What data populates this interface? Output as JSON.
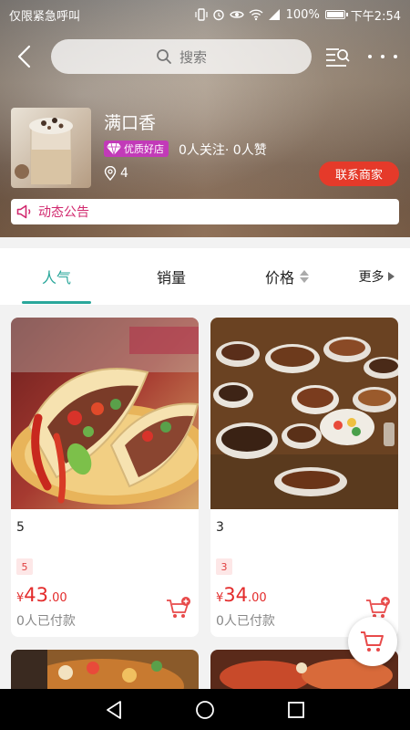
{
  "status_bar": {
    "carrier": "仅限紧急呼叫",
    "battery": "100%",
    "time": "下午2:54"
  },
  "nav": {
    "search_placeholder": "搜索"
  },
  "store": {
    "name": "满口香",
    "badge": "优质好店",
    "follow_stats": "0人关注· 0人赞",
    "location_count": "4",
    "contact_label": "联系商家",
    "notice_label": "动态公告"
  },
  "tabs": [
    {
      "label": "人气",
      "active": true
    },
    {
      "label": "销量",
      "active": false
    },
    {
      "label": "价格",
      "active": false
    },
    {
      "label": "更多",
      "active": false
    }
  ],
  "products": [
    {
      "title": "5",
      "tag": "5",
      "currency": "¥",
      "price_int": "43",
      "price_dec": ".00",
      "paid": "0人已付款",
      "image": "tacos"
    },
    {
      "title": "3",
      "tag": "3",
      "currency": "¥",
      "price_int": "34",
      "price_dec": ".00",
      "paid": "0人已付款",
      "image": "bbq-platter"
    }
  ],
  "colors": {
    "accent": "#2aa79b",
    "price": "#e32b2b",
    "contact_button": "#e53a2a",
    "notice": "#d1286e",
    "badge": "#c23ab8"
  }
}
